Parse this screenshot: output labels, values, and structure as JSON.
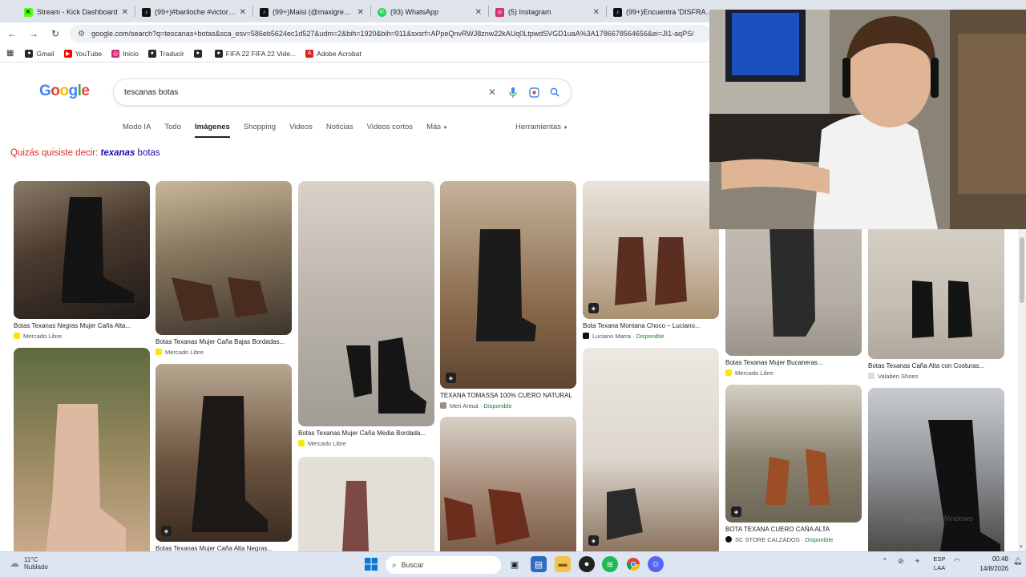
{
  "browser": {
    "tabs": [
      {
        "title": "Stream - Kick Dashboard",
        "icon": "kick-icon",
        "color": "#53fc18"
      },
      {
        "title": "(99+)#bariloche #victoriass",
        "icon": "tiktok-icon",
        "color": "#111111"
      },
      {
        "title": "(99+)Maisi (@maxigrecooc",
        "icon": "tiktok-icon",
        "color": "#111111"
      },
      {
        "title": "(93) WhatsApp",
        "icon": "whatsapp-icon",
        "color": "#25d366"
      },
      {
        "title": "(5) Instagram",
        "icon": "instagram-icon",
        "color": "#d62976"
      },
      {
        "title": "(99+)Encuentra 'DISFRACES",
        "icon": "tiktok-icon",
        "color": "#111111"
      }
    ],
    "url": "google.com/search?q=tescanas+botas&sca_esv=586eb5624ec1d527&udm=2&bih=1920&bih=911&sxsrf=APpeQnvRWJ8znw22kAUq0LtpwdSVGD1uaA%3A1786678564656&ei=JI1-aqPS/",
    "bookmarks": [
      {
        "label": "Gmail",
        "icon": "gmail-icon",
        "color": "#ea4335"
      },
      {
        "label": "YouTube",
        "icon": "youtube-icon",
        "color": "#ff0000"
      },
      {
        "label": "Inicio",
        "icon": "instagram-icon",
        "color": "#d62976"
      },
      {
        "label": "Traducir",
        "icon": "translate-icon",
        "color": "#4285f4"
      },
      {
        "label": "",
        "icon": "github-icon",
        "color": "#24292e"
      },
      {
        "label": "FIFA 22 FIFA 22 Vide...",
        "icon": "github-icon",
        "color": "#24292e"
      },
      {
        "label": "Adobe Acrobat",
        "icon": "acrobat-icon",
        "color": "#e2231a"
      }
    ]
  },
  "google": {
    "logo": "Google",
    "query": "tescanas botas",
    "nav": [
      "Modo IA",
      "Todo",
      "Imágenes",
      "Shopping",
      "Videos",
      "Noticias",
      "Videos cortos",
      "Más"
    ],
    "active_nav": "Imágenes",
    "tools": "Herramientas",
    "did_you_mean_prefix": "Quizás quisiste decir:",
    "did_you_mean_bold": "texanas",
    "did_you_mean_rest": "botas"
  },
  "results": [
    {
      "title": "Botas Texanas Negras Mujer Caña Alta...",
      "source": "Mercado Libre",
      "available": "",
      "color": "#4a3a2e",
      "badge": false
    },
    {
      "title": "",
      "source": "",
      "available": "",
      "color": "#9a8a62",
      "badge": false
    },
    {
      "title": "Botas Texanas Mujer Caña Bajas Bordadas...",
      "source": "Mercado Libre",
      "available": "",
      "color": "#6b5a48",
      "badge": false
    },
    {
      "title": "Botas Texanas Mujer Caña Alta Negras...",
      "source": "",
      "available": "",
      "color": "#3f3530",
      "badge": true
    },
    {
      "title": "Botas Texanas Mujer Caña Media Bordada...",
      "source": "Mercado Libre",
      "available": "",
      "color": "#b9b3ab",
      "badge": false
    },
    {
      "title": "",
      "source": "",
      "available": "",
      "color": "#d6cfc8",
      "badge": false
    },
    {
      "title": "TEXANA TOMASSA 100% CUERO NATURAL",
      "source": "Meri Antuá",
      "available": "Disponible",
      "color": "#5e4530",
      "badge": true
    },
    {
      "title": "",
      "source": "",
      "available": "",
      "color": "#7a5e4a",
      "badge": false
    },
    {
      "title": "Bota Texana Montana Choco – Luciano...",
      "source": "Luciano Marra",
      "available": "Disponible",
      "color": "#c9b8a5",
      "badge": true
    },
    {
      "title": "",
      "source": "",
      "available": "",
      "color": "#dcd6cc",
      "badge": true
    },
    {
      "title": "Botas Texanas Mujer Bucaneras...",
      "source": "Mercado Libre",
      "available": "",
      "color": "#b4ada4",
      "badge": false
    },
    {
      "title": "BOTA TEXANA CUERO CAÑA ALTA",
      "source": "SC STORE CALZADOS",
      "available": "Disponible",
      "color": "#8a8270",
      "badge": true
    },
    {
      "title": "Botas Texanas Caña Alta con Costuras...",
      "source": "Valaben Shoes",
      "available": "",
      "color": "#c4bdb2",
      "badge": false
    },
    {
      "title": "",
      "source": "",
      "available": "",
      "color": "#4d4a48",
      "badge": false
    }
  ],
  "overlay": {
    "watermark": "ara activar Windows"
  },
  "taskbar": {
    "temp": "11°C",
    "condition": "Nublado",
    "search": "Buscar",
    "lang_top": "ESP",
    "lang_bottom": "LAA",
    "time": "00:48",
    "date": "14/8/2026"
  }
}
